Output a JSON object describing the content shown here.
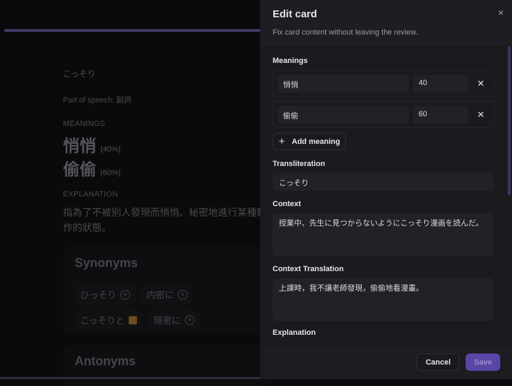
{
  "review": {
    "progress_percent": 51,
    "word": "こっそり",
    "part_of_speech": "Part of speech: 副詞",
    "meanings_label": "MEANINGS",
    "meanings": [
      {
        "text": "悄悄",
        "pct": "(40%)"
      },
      {
        "text": "偷偷",
        "pct": "(60%)"
      }
    ],
    "explanation_label": "EXPLANATION",
    "explanation": "指為了不被別人發現而悄悄、秘密地進行某種動作的狀態。",
    "synonyms_title": "Synonyms",
    "synonyms": [
      "ひっそり",
      "内密に",
      "こっそりと",
      "隠密に"
    ],
    "antonyms_title": "Antonyms"
  },
  "drawer": {
    "title": "Edit card",
    "subtitle": "Fix card content without leaving the review.",
    "close": "×",
    "meanings_label": "Meanings",
    "meanings": [
      {
        "text": "悄悄",
        "weight": "40"
      },
      {
        "text": "偷偷",
        "weight": "60"
      }
    ],
    "remove": "✕",
    "add_meaning": "Add meaning",
    "add_icon": "+",
    "transliteration_label": "Transliteration",
    "transliteration": "こっそり",
    "context_label": "Context",
    "context": "授業中、先生に見つからないようにこっそり漫画を読んだ。",
    "context_translation_label": "Context Translation",
    "context_translation": "上課時，我不讓老師發現，偷偷地看漫畫。",
    "explanation_label": "Explanation",
    "cancel": "Cancel",
    "save": "Save"
  },
  "colors": {
    "accent": "#5b45a6",
    "drawer_bg": "#1c1c21"
  }
}
